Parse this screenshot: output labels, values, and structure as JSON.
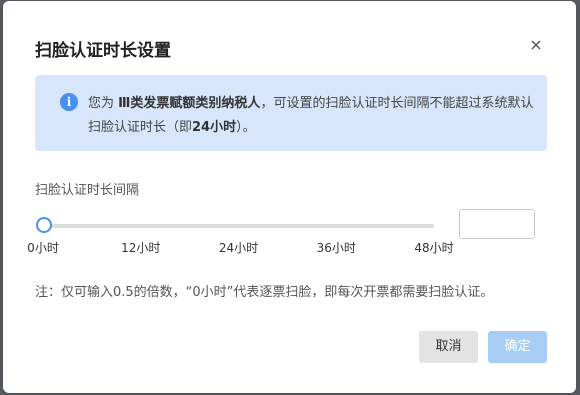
{
  "dialog": {
    "title": "扫脸认证时长设置",
    "close_icon": "close-icon"
  },
  "info": {
    "icon": "info-icon",
    "icon_glyph": "i",
    "text_prefix": "您为 ",
    "taxpayer_type": "Ⅲ类发票赋额类别纳税人",
    "text_middle": "，可设置的扫脸认证时长间隔不能超过系统默认扫脸认证时长（即",
    "default_duration": "24小时",
    "text_suffix": "）。"
  },
  "slider": {
    "label": "扫脸认证时长间隔",
    "min": 0,
    "max": 48,
    "value": 0,
    "ticks": [
      "0小时",
      "12小时",
      "24小时",
      "36小时",
      "48小时"
    ],
    "input_value": ""
  },
  "note": "注：仅可输入0.5的倍数，“0小时”代表逐票扫脸，即每次开票都需要扫脸认证。",
  "buttons": {
    "cancel": "取消",
    "confirm": "确定"
  },
  "colors": {
    "accent": "#4a8ef0",
    "info_bg": "#d7e6fb",
    "confirm_disabled": "#a8cdf5"
  }
}
